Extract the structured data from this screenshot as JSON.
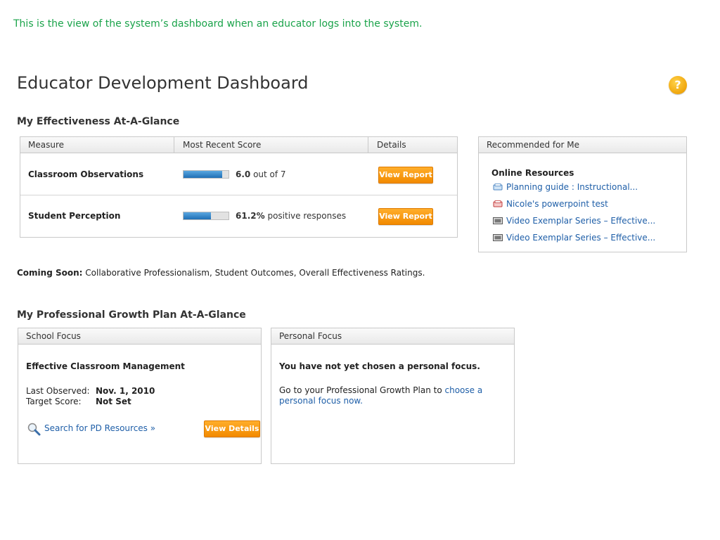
{
  "caption": "This is the view of the system’s dashboard when an educator logs into the system.",
  "page_title": "Educator Development Dashboard",
  "help_icon": "?",
  "effectiveness": {
    "title": "My Effectiveness At-A-Glance",
    "headers": [
      "Measure",
      "Most Recent Score",
      "Details"
    ],
    "rows": [
      {
        "measure": "Classroom Observations",
        "score_value": "6.0",
        "score_text": " out of 7",
        "progress": 0.86,
        "button": "View Report"
      },
      {
        "measure": "Student Perception",
        "score_value": "61.2%",
        "score_text": " positive responses",
        "progress": 0.612,
        "button": "View Report"
      }
    ]
  },
  "recommended": {
    "header": "Recommended for Me",
    "subtitle": "Online Resources",
    "items": [
      {
        "icon": "document-icon",
        "label": "Planning guide : Instructional..."
      },
      {
        "icon": "pdf-icon",
        "label": "Nicole's powerpoint test"
      },
      {
        "icon": "video-icon",
        "label": "Video Exemplar Series – Effective..."
      },
      {
        "icon": "video-icon",
        "label": "Video Exemplar Series – Effective..."
      }
    ]
  },
  "coming_soon": {
    "label": "Coming Soon:",
    "text": " Collaborative Professionalism, Student Outcomes, Overall Effectiveness Ratings."
  },
  "growth": {
    "title": "My Professional Growth Plan At-A-Glance",
    "school": {
      "header": "School Focus",
      "focus": "Effective Classroom Management",
      "last_observed_label": "Last Observed:",
      "last_observed_value": "Nov. 1, 2010",
      "target_label": "Target Score:",
      "target_value": "Not Set",
      "search_link": "Search for PD Resources »",
      "button": "View Details"
    },
    "personal": {
      "header": "Personal Focus",
      "message": "You have not yet chosen a personal focus.",
      "text": "Go to your Professional Growth Plan to ",
      "link": "choose a personal focus now."
    }
  },
  "colors": {
    "accent_orange": "#f28a00",
    "link_blue": "#1f5fa8",
    "caption_green": "#1aa34a",
    "bar_blue": "#1f6fb5"
  }
}
